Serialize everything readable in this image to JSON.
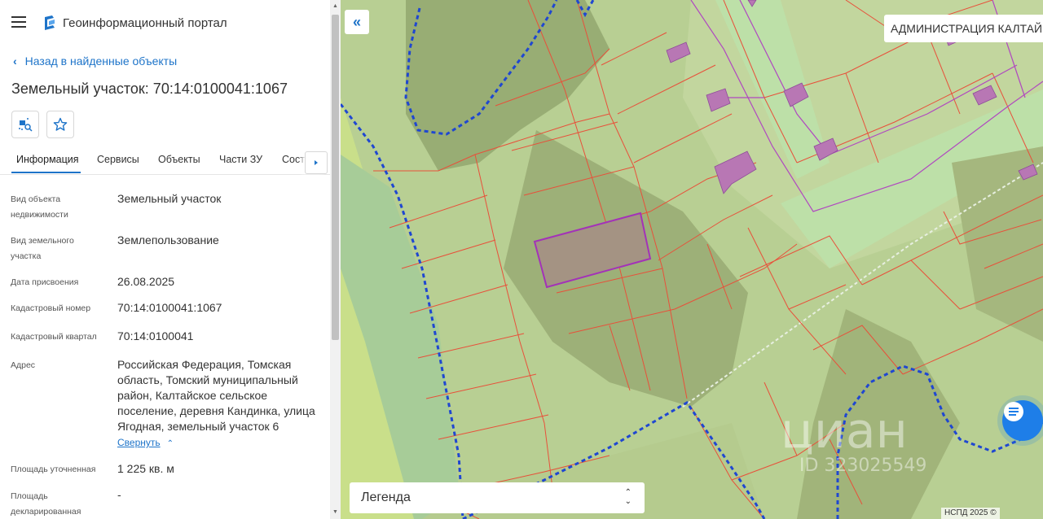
{
  "app": {
    "title": "Геоинформационный портал"
  },
  "nav": {
    "back_label": "Назад в найденные объекты"
  },
  "object": {
    "title": "Земельный участок: 70:14:0100041:1067"
  },
  "tabs": [
    {
      "label": "Информация"
    },
    {
      "label": "Сервисы"
    },
    {
      "label": "Объекты"
    },
    {
      "label": "Части ЗУ"
    },
    {
      "label": "Соста"
    }
  ],
  "fields": [
    {
      "label_l1": "Вид объекта",
      "label_l2": "недвижимости",
      "value": "Земельный участок"
    },
    {
      "label_l1": "Вид земельного",
      "label_l2": "участка",
      "value": "Землепользование"
    },
    {
      "label_l1": "Дата присвоения",
      "label_l2": "",
      "value": "26.08.2025"
    },
    {
      "label_l1": "Кадастровый номер",
      "label_l2": "",
      "value": "70:14:0100041:1067"
    },
    {
      "label_l1": "Кадастровый квартал",
      "label_l2": "",
      "value": "70:14:0100041"
    },
    {
      "label_l1": "Адрес",
      "label_l2": "",
      "value_lines": [
        "Российская Федерация, Томская",
        "область, Томский муниципальный",
        "район, Калтайское сельское",
        "поселение, деревня Кандинка, улица",
        "Ягодная, земельный участок 6"
      ]
    },
    {
      "label_l1": "Площадь уточненная",
      "label_l2": "",
      "value": "1 225 кв. м"
    },
    {
      "label_l1": "Площадь",
      "label_l2": "декларированная",
      "value": "-"
    }
  ],
  "collapse_label": "Свернуть",
  "map": {
    "admin_label": "АДМИНИСТРАЦИЯ КАЛТАЙ.",
    "legend_label": "Легенда",
    "copyright": "НСПД 2025 ©",
    "watermark": "циан",
    "watermark_id": "ID 323025549"
  },
  "colors": {
    "accent": "#1e74c9",
    "parcel_border": "#e8503a",
    "selected_parcel": "#a332b8"
  },
  "icons": {
    "menu": "hamburger-icon",
    "logo": "portal-logo-icon",
    "search_map": "map-search-icon",
    "favorite": "star-icon",
    "chat": "chat-icon"
  }
}
